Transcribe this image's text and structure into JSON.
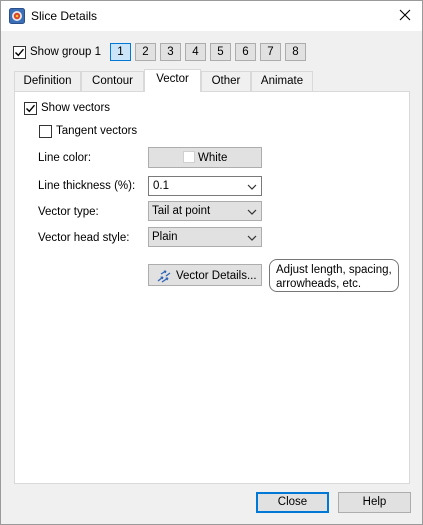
{
  "window": {
    "title": "Slice Details",
    "icon": "tecplot-slice-icon",
    "close_icon": "close-icon"
  },
  "show_group": {
    "label": "Show group 1",
    "checked": true,
    "groups": [
      "1",
      "2",
      "3",
      "4",
      "5",
      "6",
      "7",
      "8"
    ],
    "active_group": "1"
  },
  "tabs": [
    {
      "label": "Definition",
      "selected": false
    },
    {
      "label": "Contour",
      "selected": false
    },
    {
      "label": "Vector",
      "selected": true
    },
    {
      "label": "Other",
      "selected": false
    },
    {
      "label": "Animate",
      "selected": false
    }
  ],
  "vector": {
    "show_vectors": {
      "label": "Show vectors",
      "checked": true
    },
    "tangent_vectors": {
      "label": "Tangent vectors",
      "checked": false
    },
    "line_color": {
      "label": "Line color:",
      "value": "White",
      "swatch": "#ffffff"
    },
    "line_thickness": {
      "label": "Line thickness (%):",
      "value": "0.1"
    },
    "vector_type": {
      "label": "Vector type:",
      "value": "Tail at point"
    },
    "head_style": {
      "label": "Vector head style:",
      "value": "Plain"
    },
    "details_button": {
      "label": "Vector Details...",
      "icon": "vector-field-icon"
    },
    "details_hint": [
      "Adjust length, spacing,",
      "arrowheads, etc."
    ]
  },
  "footer": {
    "close_label": "Close",
    "help_label": "Help"
  }
}
